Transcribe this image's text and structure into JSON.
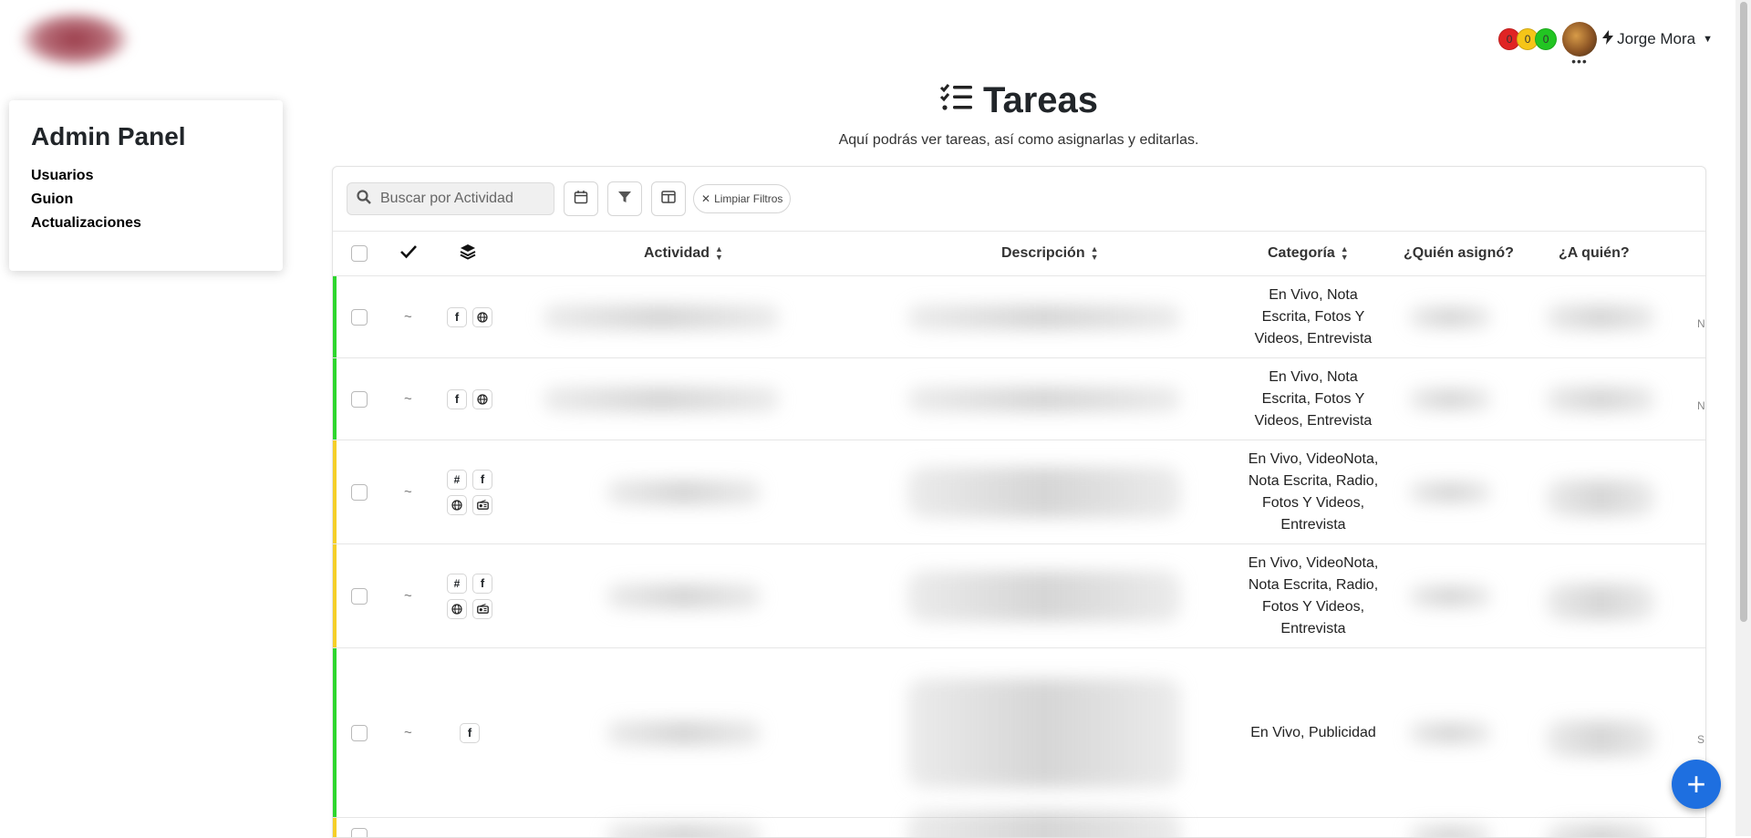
{
  "sidebar": {
    "title": "Admin Panel",
    "items": [
      {
        "label": "Usuarios"
      },
      {
        "label": "Guion"
      },
      {
        "label": "Actualizaciones"
      }
    ]
  },
  "header": {
    "counters": [
      {
        "value": "0",
        "color": "#e02424"
      },
      {
        "value": "0",
        "color": "#f5c518"
      },
      {
        "value": "0",
        "color": "#22c522"
      }
    ],
    "user_name": "Jorge Mora",
    "avatar_dots": "•••"
  },
  "page": {
    "title": "Tareas",
    "subtitle": "Aquí podrás ver tareas, así como asignarlas y editarlas."
  },
  "toolbar": {
    "search_placeholder": "Buscar por Actividad",
    "clear_label": "Limpiar Filtros"
  },
  "table": {
    "headers": {
      "activity": "Actividad",
      "description": "Descripción",
      "category": "Categoría",
      "assigned_by": "¿Quién asignó?",
      "assigned_to": "¿A quién?"
    },
    "rows": [
      {
        "status_color": "#2dd62d",
        "done": "~",
        "platforms": [
          "facebook",
          "globe"
        ],
        "category": "En Vivo, Nota Escrita, Fotos Y Videos, Entrevista",
        "overflow": "N"
      },
      {
        "status_color": "#2dd62d",
        "done": "~",
        "platforms": [
          "facebook",
          "globe"
        ],
        "category": "En Vivo, Nota Escrita, Fotos Y Videos, Entrevista",
        "overflow": "N"
      },
      {
        "status_color": "#f5cf28",
        "done": "~",
        "platforms": [
          "hashtag",
          "facebook",
          "globe",
          "radio"
        ],
        "category": "En Vivo, VideoNota, Nota Escrita, Radio, Fotos Y Videos, Entrevista",
        "overflow": ""
      },
      {
        "status_color": "#f5cf28",
        "done": "~",
        "platforms": [
          "hashtag",
          "facebook",
          "globe",
          "radio"
        ],
        "category": "En Vivo, VideoNota, Nota Escrita, Radio, Fotos Y Videos, Entrevista",
        "overflow": ""
      },
      {
        "status_color": "#2dd62d",
        "done": "~",
        "platforms": [
          "facebook"
        ],
        "category": "En Vivo, Publicidad",
        "overflow": "S"
      },
      {
        "status_color": "#f5cf28",
        "done": "",
        "platforms": [],
        "category": "",
        "overflow": ""
      }
    ]
  },
  "fab_label": "+"
}
